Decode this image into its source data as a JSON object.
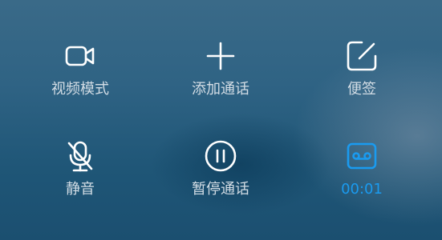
{
  "colors": {
    "icon": "#ffffff",
    "label": "#d3dde5",
    "accent": "#1a9bf0"
  },
  "actions": [
    {
      "label": "视频模式",
      "icon": "video-camera-icon"
    },
    {
      "label": "添加通话",
      "icon": "plus-icon"
    },
    {
      "label": "便签",
      "icon": "note-edit-icon"
    },
    {
      "label": "静音",
      "icon": "mic-muted-icon"
    },
    {
      "label": "暂停通话",
      "icon": "pause-icon"
    },
    {
      "label": "00:01",
      "icon": "voicemail-record-icon"
    }
  ]
}
